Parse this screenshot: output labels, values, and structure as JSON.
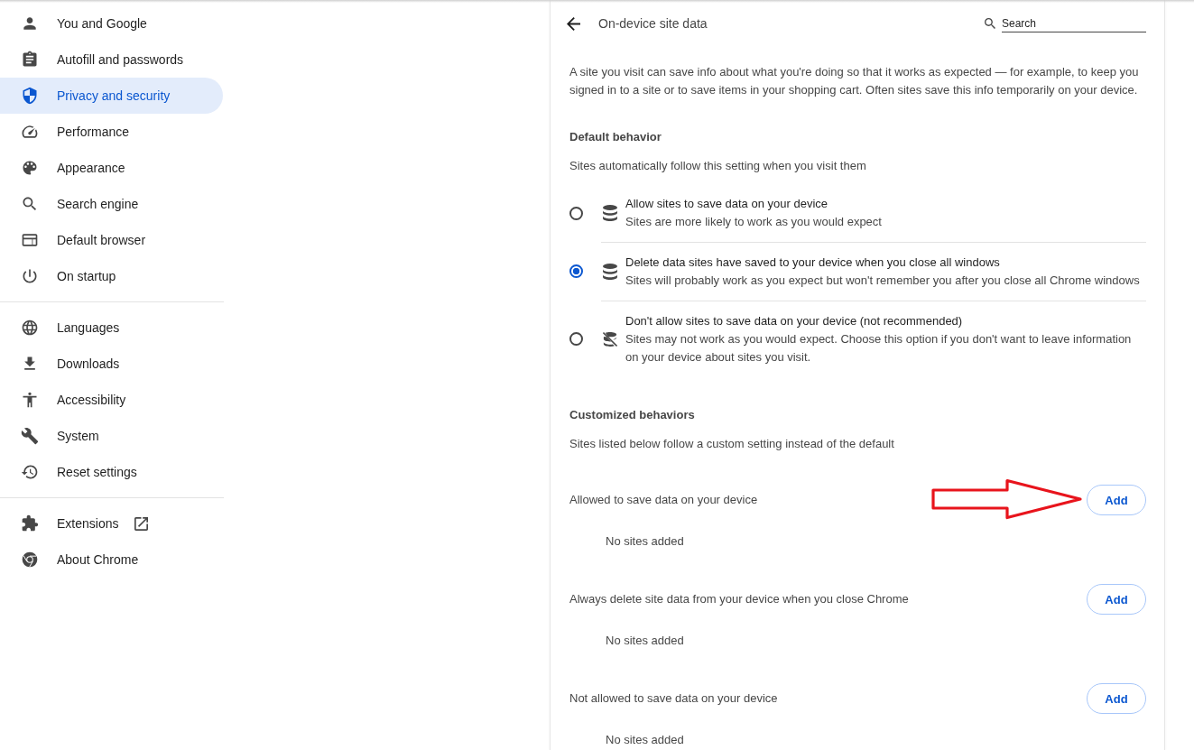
{
  "sidebar": {
    "groups": [
      {
        "items": [
          {
            "label": "You and Google",
            "selected": false,
            "opens_external": false
          },
          {
            "label": "Autofill and passwords",
            "selected": false,
            "opens_external": false
          },
          {
            "label": "Privacy and security",
            "selected": true,
            "opens_external": false
          },
          {
            "label": "Performance",
            "selected": false,
            "opens_external": false
          },
          {
            "label": "Appearance",
            "selected": false,
            "opens_external": false
          },
          {
            "label": "Search engine",
            "selected": false,
            "opens_external": false
          },
          {
            "label": "Default browser",
            "selected": false,
            "opens_external": false
          },
          {
            "label": "On startup",
            "selected": false,
            "opens_external": false
          }
        ]
      },
      {
        "items": [
          {
            "label": "Languages",
            "selected": false,
            "opens_external": false
          },
          {
            "label": "Downloads",
            "selected": false,
            "opens_external": false
          },
          {
            "label": "Accessibility",
            "selected": false,
            "opens_external": false
          },
          {
            "label": "System",
            "selected": false,
            "opens_external": false
          },
          {
            "label": "Reset settings",
            "selected": false,
            "opens_external": false
          }
        ]
      },
      {
        "items": [
          {
            "label": "Extensions",
            "selected": false,
            "opens_external": true
          },
          {
            "label": "About Chrome",
            "selected": false,
            "opens_external": false
          }
        ]
      }
    ]
  },
  "page": {
    "title": "On-device site data",
    "search": {
      "placeholder": "Search"
    },
    "intro": "A site you visit can save info about what you're doing so that it works as expected — for example, to keep you signed in to a site or to save items in your shopping cart. Often sites save this info temporarily on your device.",
    "default_behavior": {
      "heading": "Default behavior",
      "subtitle": "Sites automatically follow this setting when you visit them",
      "options": [
        {
          "kind": "allow",
          "title": "Allow sites to save data on your device",
          "description": "Sites are more likely to work as you would expect",
          "selected": false
        },
        {
          "kind": "clear_on_exit",
          "title": "Delete data sites have saved to your device when you close all windows",
          "description": "Sites will probably work as you expect but won't remember you after you close all Chrome windows",
          "selected": true
        },
        {
          "kind": "block",
          "title": "Don't allow sites to save data on your device (not recommended)",
          "description": "Sites may not work as you would expect. Choose this option if you don't want to leave information on your device about sites you visit.",
          "selected": false
        }
      ]
    },
    "customized_behaviors": {
      "heading": "Customized behaviors",
      "subtitle": "Sites listed below follow a custom setting instead of the default",
      "sections": [
        {
          "label": "Allowed to save data on your device",
          "button": "Add",
          "empty_text": "No sites added",
          "marked_by_arrow": true
        },
        {
          "label": "Always delete site data from your device when you close Chrome",
          "button": "Add",
          "empty_text": "No sites added",
          "marked_by_arrow": false
        },
        {
          "label": "Not allowed to save data on your device",
          "button": "Add",
          "empty_text": "No sites added",
          "marked_by_arrow": false
        }
      ]
    }
  }
}
